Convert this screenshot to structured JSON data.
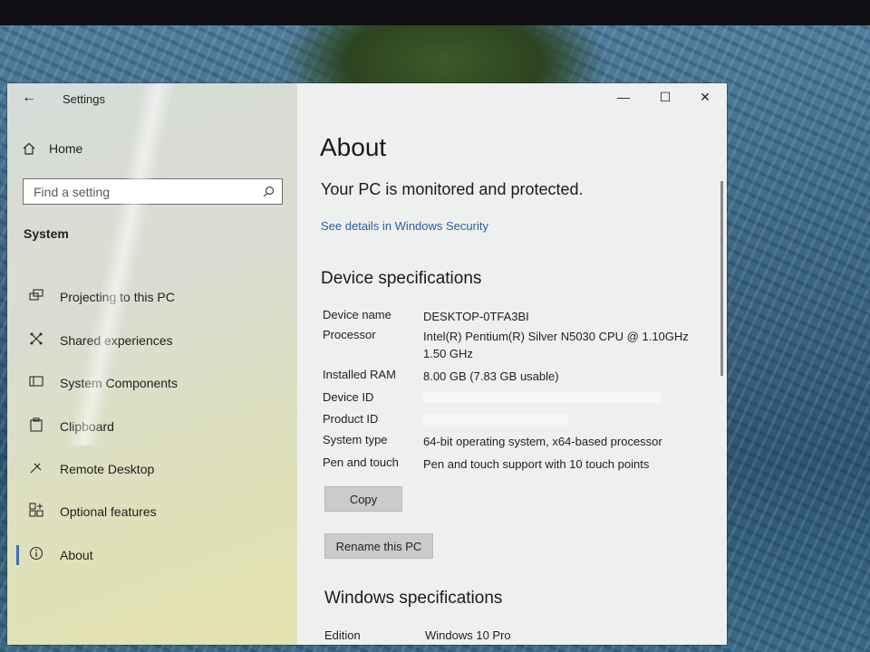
{
  "window": {
    "title": "Settings",
    "controls": {
      "minimize": "—",
      "maximize": "☐",
      "close": "✕"
    }
  },
  "nav": {
    "home_label": "Home",
    "search_placeholder": "Find a setting",
    "section_label": "System",
    "items": [
      {
        "label": "Projecting to this PC",
        "icon": "projector-icon"
      },
      {
        "label": "Shared experiences",
        "icon": "shared-experiences-icon"
      },
      {
        "label": "System Components",
        "icon": "system-components-icon"
      },
      {
        "label": "Clipboard",
        "icon": "clipboard-icon"
      },
      {
        "label": "Remote Desktop",
        "icon": "remote-desktop-icon"
      },
      {
        "label": "Optional features",
        "icon": "optional-features-icon"
      },
      {
        "label": "About",
        "icon": "info-icon",
        "active": true
      }
    ]
  },
  "content": {
    "title": "About",
    "protection_status": "Your PC is monitored and protected.",
    "security_link": "See details in Windows Security",
    "device_spec_heading": "Device specifications",
    "device_specs": [
      {
        "key": "Device name",
        "value": "DESKTOP-0TFA3BI"
      },
      {
        "key": "Processor",
        "value": "Intel(R) Pentium(R) Silver N5030 CPU @ 1.10GHz",
        "value2": "1.50 GHz"
      },
      {
        "key": "Installed RAM",
        "value": "8.00 GB (7.83 GB usable)"
      },
      {
        "key": "Device ID",
        "value": ""
      },
      {
        "key": "Product ID",
        "value": ""
      },
      {
        "key": "System type",
        "value": "64-bit operating system, x64-based processor"
      },
      {
        "key": "Pen and touch",
        "value": "Pen and touch support with 10 touch points"
      }
    ],
    "copy_button": "Copy",
    "rename_button": "Rename this PC",
    "windows_spec_heading": "Windows specifications",
    "edition_key": "Edition",
    "edition_value": "Windows 10 Pro"
  },
  "colors": {
    "accent": "#3e6fb5",
    "link": "#2a5da8"
  }
}
